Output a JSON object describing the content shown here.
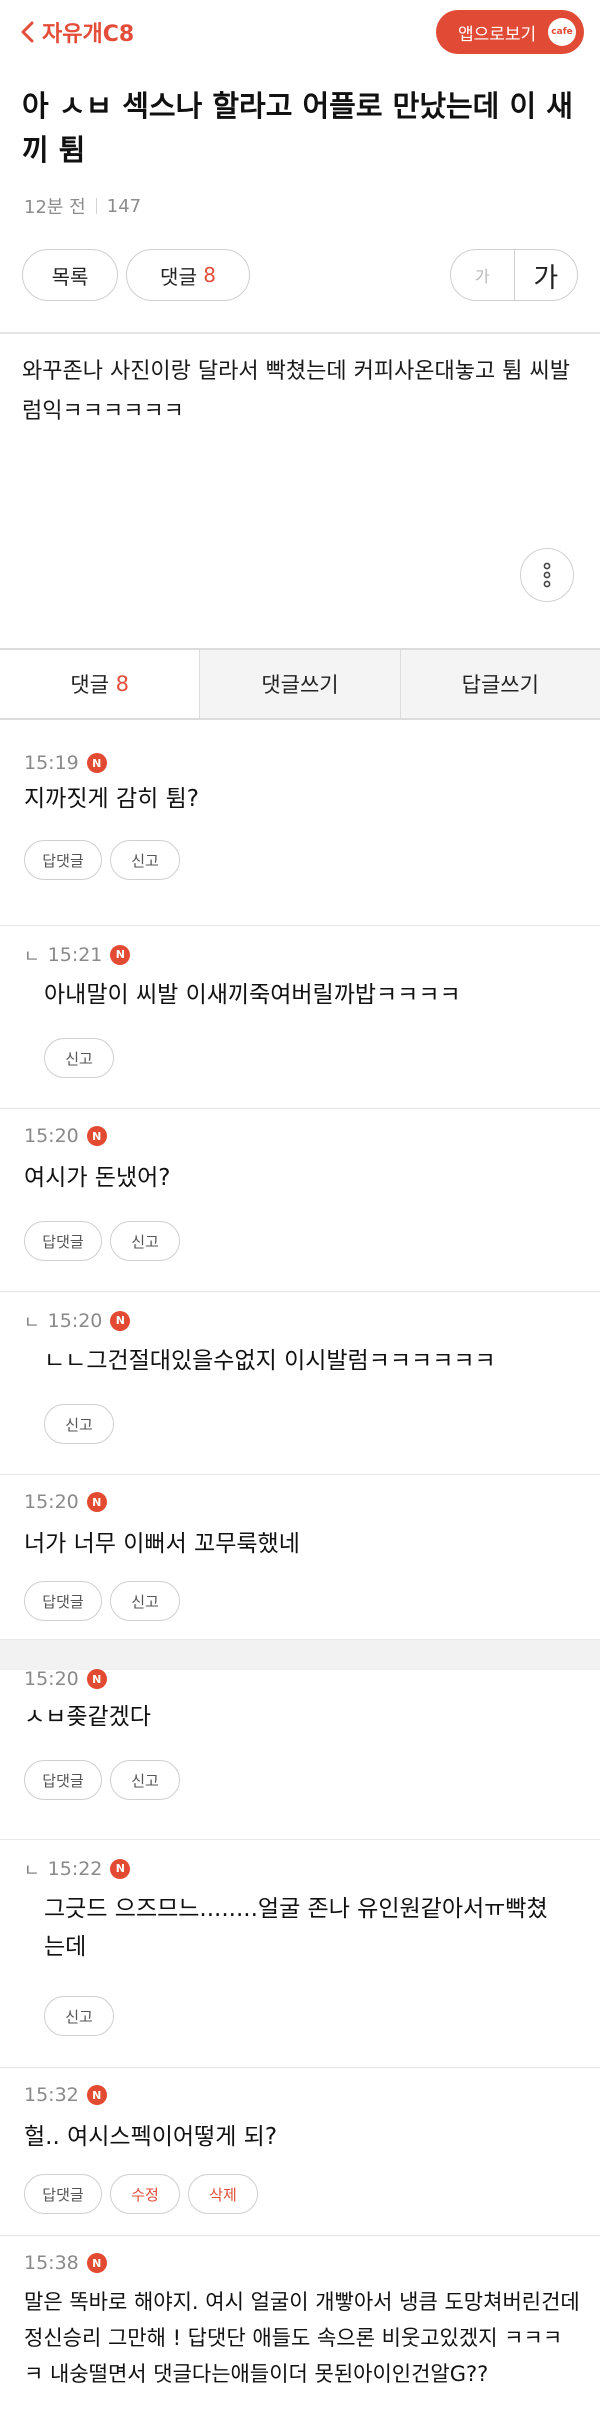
{
  "header": {
    "back_label": "자유개C8",
    "app_button_label": "앱으로보기",
    "app_badge": "cafe"
  },
  "post": {
    "title": "아 ㅅㅂ 섹스나 할라고 어플로 만났는데 이 새끼 튐",
    "time": "12분 전",
    "views": "147",
    "body": "와꾸존나 사진이랑 달라서 빡쳤는데 커피사온대놓고 튐 씨발럼익ㅋㅋㅋㅋㅋㅋ"
  },
  "actions": {
    "list_label": "목록",
    "comment_label": "댓글",
    "comment_count": "8",
    "font_small": "가",
    "font_large": "가"
  },
  "tabs": {
    "comments_label": "댓글",
    "comments_count": "8",
    "write_comment": "댓글쓰기",
    "write_reply": "답글쓰기"
  },
  "badge_new": "N",
  "reply_marker": "ㄴ",
  "buttons": {
    "reply": "답댓글",
    "report": "신고",
    "edit": "수정",
    "delete": "삭제"
  },
  "comments": [
    {
      "time": "15:19",
      "text": "지까짓게 감히 튐?"
    },
    {
      "time": "15:21",
      "text": "아내말이 씨발 이새끼죽여버릴까밥ㅋㅋㅋㅋ"
    },
    {
      "time": "15:20",
      "text": "여시가 돈냈어?"
    },
    {
      "time": "15:20",
      "text": "ㄴㄴ그건절대있을수없지 이시발럼ㅋㅋㅋㅋㅋㅋ"
    },
    {
      "time": "15:20",
      "text": "너가 너무 이뻐서 꼬무룩했네"
    },
    {
      "time": "15:20",
      "text": "ㅅㅂ좆같겠다"
    },
    {
      "time": "15:22",
      "text": "그긋드 으즈므느........얼굴 존나 유인원같아서ㅠ빡쳤는데"
    },
    {
      "time": "15:32",
      "text": "헐.. 여시스펙이어떻게 되?"
    },
    {
      "time": "15:38",
      "text": "말은 똑바로 해야지. 여시 얼굴이 개빻아서 냉큼 도망쳐버린건데 정신승리 그만해 ! 답댓단 애들도 속으론 비웃고있겠지 ㅋㅋㅋㅋ 내숭떨면서 댓글다는애들이더 못된아이인건알G??"
    }
  ]
}
